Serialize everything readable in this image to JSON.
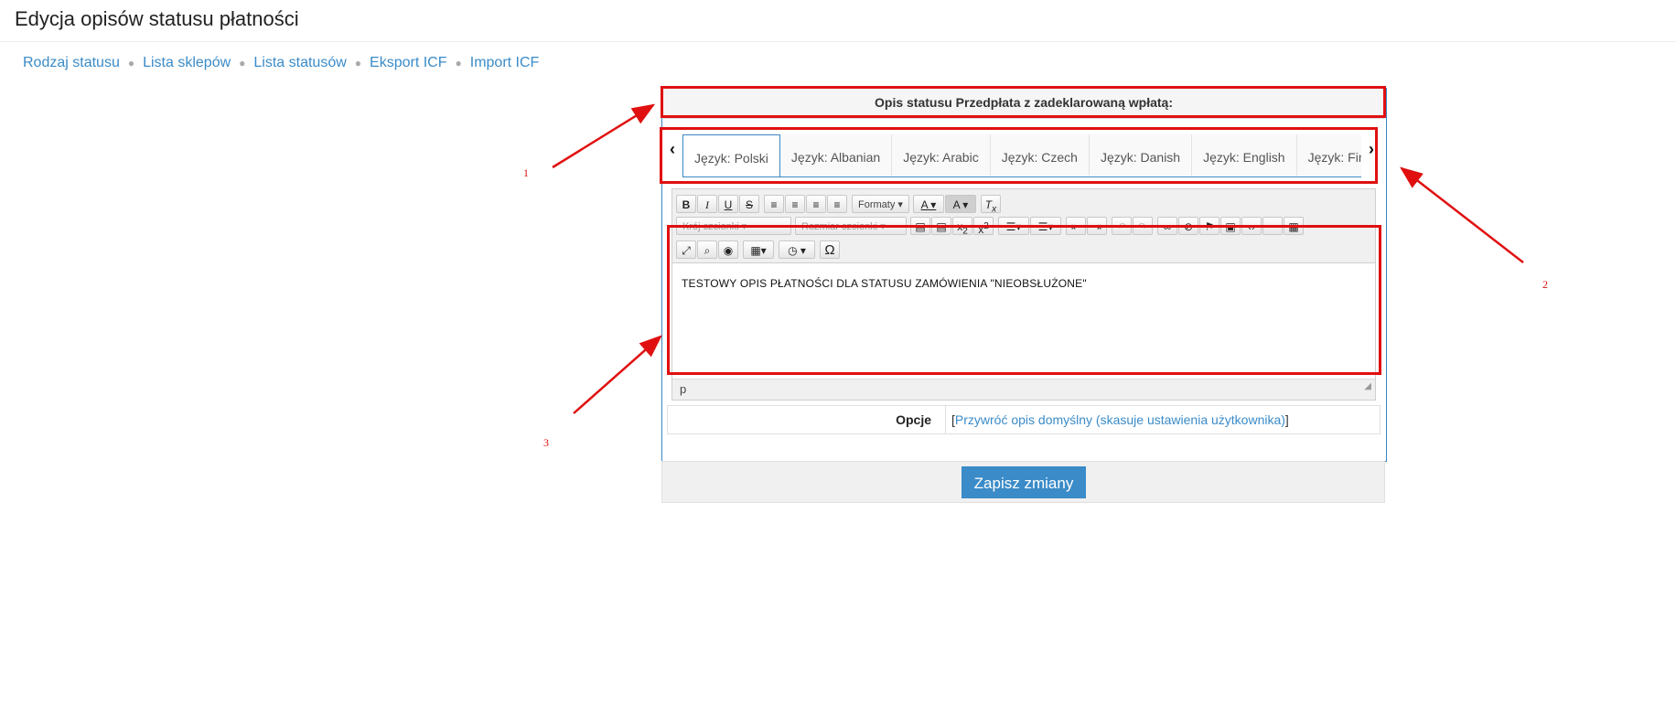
{
  "page": {
    "title": "Edycja opisów statusu płatności"
  },
  "breadcrumb": [
    {
      "label": "Rodzaj statusu"
    },
    {
      "label": "Lista sklepów"
    },
    {
      "label": "Lista statusów"
    },
    {
      "label": "Eksport ICF"
    },
    {
      "label": "Import ICF"
    }
  ],
  "panel": {
    "header": "Opis statusu Przedpłata z zadeklarowaną wpłatą:"
  },
  "tabs": [
    {
      "label": "Język: Polski",
      "active": true
    },
    {
      "label": "Język: Albanian"
    },
    {
      "label": "Język: Arabic"
    },
    {
      "label": "Język: Czech"
    },
    {
      "label": "Język: Danish"
    },
    {
      "label": "Język: English"
    },
    {
      "label": "Język: Fin"
    }
  ],
  "toolbar": {
    "formats_label": "Formaty",
    "font_family_label": "Krój czcionki",
    "font_size_label": "Rozmiar czcionki"
  },
  "editor": {
    "content": "TESTOWY OPIS PŁATNOŚCI DLA STATUSU ZAMÓWIENIA \"NIEOBSŁUŻONE\"",
    "status_path": "p"
  },
  "options": {
    "label": "Opcje",
    "bracket_open": "[",
    "link_text": "Przywróć opis domyślny (skasuje ustawienia użytkownika)",
    "bracket_close": "]"
  },
  "actions": {
    "save_label": "Zapisz zmiany"
  },
  "annotations": {
    "numbers": [
      "1",
      "2",
      "3"
    ],
    "color": "#e01010"
  },
  "colors": {
    "link": "#3a8bc8",
    "primary_button": "#3a8bc8",
    "panel_border": "#3b87c4"
  }
}
